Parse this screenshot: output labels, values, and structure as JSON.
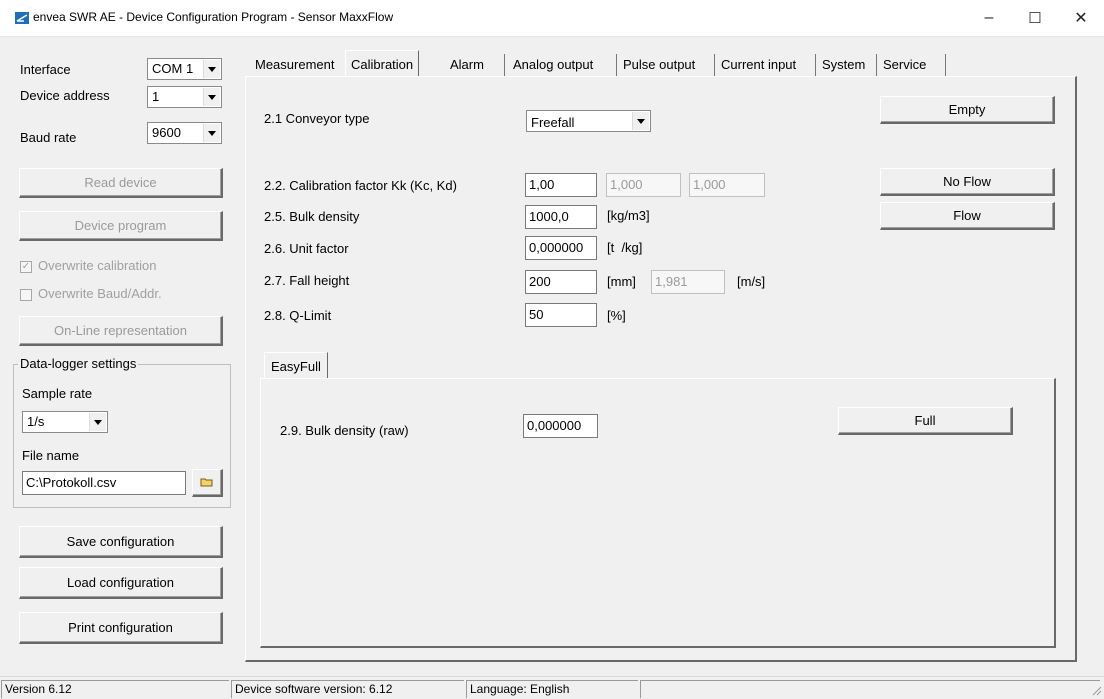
{
  "window": {
    "title": "envea SWR AE - Device Configuration Program - Sensor MaxxFlow",
    "minimize_glyph": "–",
    "maximize_glyph": "☐",
    "close_glyph": "✕"
  },
  "left": {
    "interface_label": "Interface",
    "interface_value": "COM 1",
    "device_address_label": "Device address",
    "device_address_value": "1",
    "baud_rate_label": "Baud rate",
    "baud_rate_value": "9600",
    "read_device": "Read device",
    "device_program": "Device program",
    "overwrite_calibration": "Overwrite calibration",
    "overwrite_baud": "Overwrite Baud/Addr.",
    "online_representation": "On-Line representation",
    "datalogger_title": "Data-logger settings",
    "sample_rate_label": "Sample rate",
    "sample_rate_value": "1/s",
    "file_name_label": "File name",
    "file_name_value": "C:\\Protokoll.csv",
    "save_configuration": "Save configuration",
    "load_configuration": "Load configuration",
    "print_configuration": "Print configuration"
  },
  "tabs": [
    "Measurement",
    "Calibration",
    "Alarm",
    "Analog output",
    "Pulse output",
    "Current input",
    "System",
    "Service"
  ],
  "active_tab": "Calibration",
  "calibration": {
    "conveyor_type_label": "2.1 Conveyor type",
    "conveyor_type_value": "Freefall",
    "cal_factor_label": "2.2. Calibration factor Kk (Kc, Kd)",
    "cal_factor_kk": "1,00",
    "cal_factor_kc": "1,000",
    "cal_factor_kd": "1,000",
    "bulk_density_label": "2.5. Bulk density",
    "bulk_density_value": "1000,0",
    "bulk_density_unit": "[kg/m3]",
    "unit_factor_label": "2.6. Unit factor",
    "unit_factor_value": "0,000000",
    "unit_factor_unit": "[t  /kg]",
    "fall_height_label": "2.7. Fall height",
    "fall_height_value": "200",
    "fall_height_unit": "[mm]",
    "fall_speed_value": "1,981",
    "fall_speed_unit": "[m/s]",
    "q_limit_label": "2.8. Q-Limit",
    "q_limit_value": "50",
    "q_limit_unit": "[%]",
    "empty_button": "Empty",
    "noflow_button": "No Flow",
    "flow_button": "Flow",
    "easyfull_tab": "EasyFull",
    "bulk_raw_label": "2.9. Bulk density (raw)",
    "bulk_raw_value": "0,000000",
    "full_button": "Full"
  },
  "status": {
    "version": "Version 6.12",
    "device_sw": "Device software version: 6.12",
    "language": "Language: English"
  }
}
